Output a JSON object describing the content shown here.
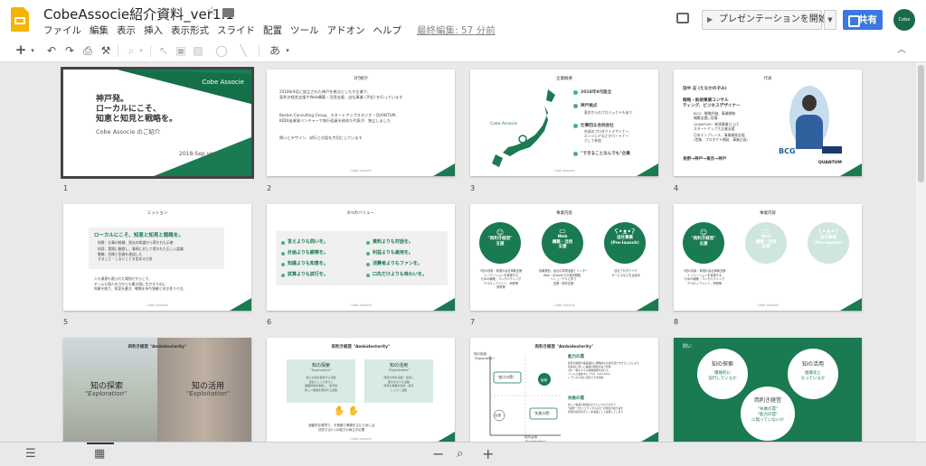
{
  "header": {
    "doc_title": "CobeAssocie紹介資料_ver1.1",
    "last_edit": "最終編集: 57 分前",
    "present_label": "プレゼンテーションを開始",
    "share_label": "共有",
    "avatar_text": "Cobe Associe"
  },
  "menu": [
    "ファイル",
    "編集",
    "表示",
    "挿入",
    "表示形式",
    "スライド",
    "配置",
    "ツール",
    "アドオン",
    "ヘルプ"
  ],
  "toolbar": {
    "text_input": "あ"
  },
  "slides": [
    {
      "num": "1",
      "brand": "Cobe Associe",
      "title": "神戸発。\nローカルにこそ、\n知恵と知見と戦略を。",
      "sub": "Cobe Associe のご紹介",
      "date": "2018-Sep ver."
    },
    {
      "num": "2",
      "title": "3行紹介",
      "b1": "2018年9月に設立された神戸を拠点としたか企業で、\n面利き経営支援やWeb構築・活用支援、自社事業 (予定) を行っています",
      "b2": "Boston Consulting Group、スタートアップスタジオ・QUANTUM、\nKDDI出資発ベンチャーで執行役員を務めた代表が、独立しました",
      "b3": "問いとデザイン、試行と対話を大切にしています",
      "foot": "Cobe Associe"
    },
    {
      "num": "3",
      "title": "企業概要",
      "brand": "Cobe Associe",
      "i1": "2018年9月設立",
      "i2": "神戸拠点",
      "i2s": "東京からのプロジェクトもあり",
      "i3": "仕事回る合同会社",
      "i3s": "外部のプロダクトデザイナー、\nエンジニアなどがパートナー\nとして参加",
      "i4": "\"できることなんでも\"企業",
      "foot": "Cobe Associe"
    },
    {
      "num": "4",
      "title": "代表",
      "name": "田中 志 (たなかのぞみ)",
      "role": "戦略・新規事業コンサル\nティング、ビジネスデザイナー",
      "d1": "BCG：戦略評価、事業戦略\n構築支援に従事",
      "d2": "QUANTUM：新規事業立上げ、\nスタートアップ大企業支援",
      "d3": "日本エンプレース：事業開発全般\n(営業、プロダクト開発、事業企画)",
      "path": "長野→神戸→東京→神戸",
      "logo1": "BCG",
      "logo2": "QUANTUM",
      "foot": "Cobe Associe"
    },
    {
      "num": "5",
      "title": "ミッション",
      "head": "ローカルにこそ、知恵と知見と戦略を。",
      "l1": "知恵：仕事の経験、過去の知識から導かれた示唆",
      "l2": "知見：実際に観察し、事柄に対して導かれた正しい認識",
      "l3": "戦略：目標と到達を達成した\nすること・しないことを定める方針",
      "p": "人も資源も限られた場所だからこそ、\nチームも個人の力からも最大限に生かすために\n知恵を絞り、知見を磨き、戦略を持ち独善と向き合うべき。",
      "foot": "Cobe Associe"
    },
    {
      "num": "6",
      "title": "8つのバリュー",
      "v": [
        "答えよりも問いを。",
        "計画よりも観察を。",
        "知識よりも知恵を。",
        "試算よりも試行を。",
        "資料よりも対話を。",
        "利益よりも雇用を。",
        "消費者よりもファンを。",
        "口先だけよりも味わいを。"
      ],
      "foot": "Cobe Associe"
    },
    {
      "num": "7",
      "title": "事業内容",
      "c1": "\"両利き経営\"\n支援",
      "c2": "Web\n構築・活用\n支援",
      "c3": "自社事業\n(Pre-launch)",
      "t1": "3億の改善・新規の会社構築支援\nイノベーションを実現する\nための戦略・コンサルティング\nデベロップメント、研修等\n研修等",
      "t2": "情報発信、会社の事業活動とインター\nWeb・Shopifyでの受託開発、\nリニューアルに伴う\n支援・制作支援",
      "t3": "自社プロダクトや\nサービスなどを企画中",
      "foot": "Cobe Associe"
    },
    {
      "num": "8",
      "title": "事業内容",
      "c1": "\"両利き経営\"\n支援",
      "c2": "Web\n構築・活用\n支援",
      "c3": "自社事業\n(Pre-launch)",
      "t1": "3億の改善・新規の会社構築支援\nイノベーションを実現する\nための戦略・コンサルティング\nデベロップメント、研修等",
      "foot": "Cobe Associe"
    },
    {
      "num": "9",
      "title": "両利き経営 \"Ambidexterity\"",
      "l": "知の探索",
      "ls": "\"Exploration\"",
      "r": "知の活用",
      "rs": "\"Exploitation\""
    },
    {
      "num": "10",
      "title": "両利き経営 \"Ambidexterity\"",
      "l": "知の探索",
      "ls": "\"Exploration\"",
      "lt": "新たな知を探索する活動\n自社にとって新たに\n事業領域を開拓し、新天地\n新しい価値を発見する活動",
      "r": "知の活用",
      "rs": "\"Exploitation\"",
      "rt": "既存の知を深堀・活用し\n磨きをかける活動\n既存の事業を強化・改善\nしていく活動",
      "b": "波動的な環境で、中長期で業績を生むためには\n拮抗する2つの能力の両立が必要",
      "foot": "Cobe Associe"
    },
    {
      "num": "11",
      "title": "両利き経営 \"Ambidexterity\"",
      "y": "知の探索\n\"Exploration\"",
      "x": "知の活用\n\"Exploitation\"",
      "q1": "\"能力の罠\"",
      "q2": "組織",
      "q3": "出張",
      "q4": "\"失敗の罠\"",
      "h1": "能力の罠",
      "t1": "既存の組織や事業強化に戦略的な比重を置きすぎることにより、\n将来的に新しい事業の開拓を失う状態\n(例) 一眼カメラの技術開発を続ける\nフィルム会社ISO、FUJI、Cam.Films\n→ デジタル化に即応できず倒産",
      "h2": "失敗の罠",
      "t2": "新しい事業の開拓ばかりにこだわりすぎて\n\"失敗\"\"プロジェクトやるほど\"の何度か繰り返す\n新規の投資を行い、新事業として失敗してしまう",
      "foot": "Cobe Associe"
    },
    {
      "num": "12",
      "title": "問い",
      "a": "知の探索",
      "as": "積極的に\n実行しているか",
      "b": "知の活用",
      "bs": "組織化と\nなっているか",
      "c": "両利き経営",
      "cs": "\"失敗の罠\"\n\"能力の罠\"\nに陥っていないか"
    }
  ]
}
